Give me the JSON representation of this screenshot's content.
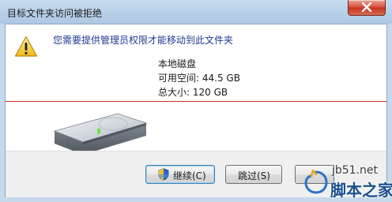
{
  "window": {
    "title": "目标文件夹访问被拒绝"
  },
  "dialog": {
    "message": "您需要提供管理员权限才能移动到此文件夹",
    "drive_name": "本地磁盘",
    "free_space": "可用空间: 44.5 GB",
    "total_size": "总大小: 120 GB"
  },
  "buttons": {
    "continue_label": "继续(C)",
    "skip_label": "跳过(S)",
    "cancel_label": ""
  },
  "watermark": {
    "url": "jb51.net",
    "name": "脚本之家"
  },
  "colors": {
    "message_text": "#1f3a93",
    "title_bar": "#b8cfe7",
    "close_button": "#c53420",
    "red_line": "#d42a2a"
  },
  "icons": {
    "close": "close-icon",
    "warning": "warning-icon",
    "drive": "hard-drive-icon",
    "shield": "uac-shield-icon"
  }
}
